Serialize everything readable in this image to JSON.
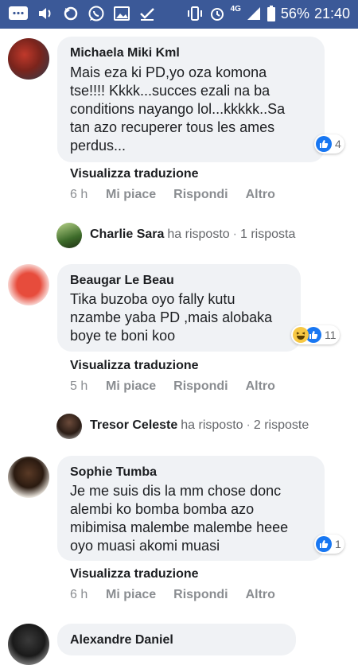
{
  "status_bar": {
    "network": "4G",
    "battery": "56%",
    "time": "21:40"
  },
  "comments": [
    {
      "author": "Michaela Miki Kml",
      "text_lines": [
        "Mais eza ki PD,yo oza komona",
        "tse!!!! Kkkk...succes ezali na ba",
        "conditions nayango lol...kkkkk..Sa",
        "tan azo recuperer tous les ames",
        "perdus..."
      ],
      "reaction_count": "4",
      "translate": "Visualizza traduzione",
      "time": "6 h",
      "like": "Mi piace",
      "reply": "Rispondi",
      "more": "Altro",
      "reply_preview": {
        "name": "Charlie Sara",
        "action": "ha risposto",
        "count": "1 risposta"
      }
    },
    {
      "author": "Beaugar Le Beau",
      "text_lines": [
        "Tika buzoba oyo fally kutu",
        "nzambe yaba PD ,mais alobaka",
        "boye te boni koo"
      ],
      "reaction_count": "11",
      "translate": "Visualizza traduzione",
      "time": "5 h",
      "like": "Mi piace",
      "reply": "Rispondi",
      "more": "Altro",
      "reply_preview": {
        "name": "Tresor Celeste",
        "action": "ha risposto",
        "count": "2 risposte"
      }
    },
    {
      "author": "Sophie Tumba",
      "text_lines": [
        "Je me suis dis la mm chose donc",
        "alembi ko bomba bomba azo",
        "mibimisa malembe malembe heee",
        "oyo muasi akomi muasi"
      ],
      "reaction_count": "1",
      "translate": "Visualizza traduzione",
      "time": "6 h",
      "like": "Mi piace",
      "reply": "Rispondi",
      "more": "Altro"
    }
  ],
  "partial_comment": {
    "author": "Alexandre Daniel"
  },
  "colors": {
    "status_bar": "#3b5998",
    "like_blue": "#1877f2",
    "bubble": "#f0f2f5",
    "meta_gray": "#8a8d91"
  }
}
